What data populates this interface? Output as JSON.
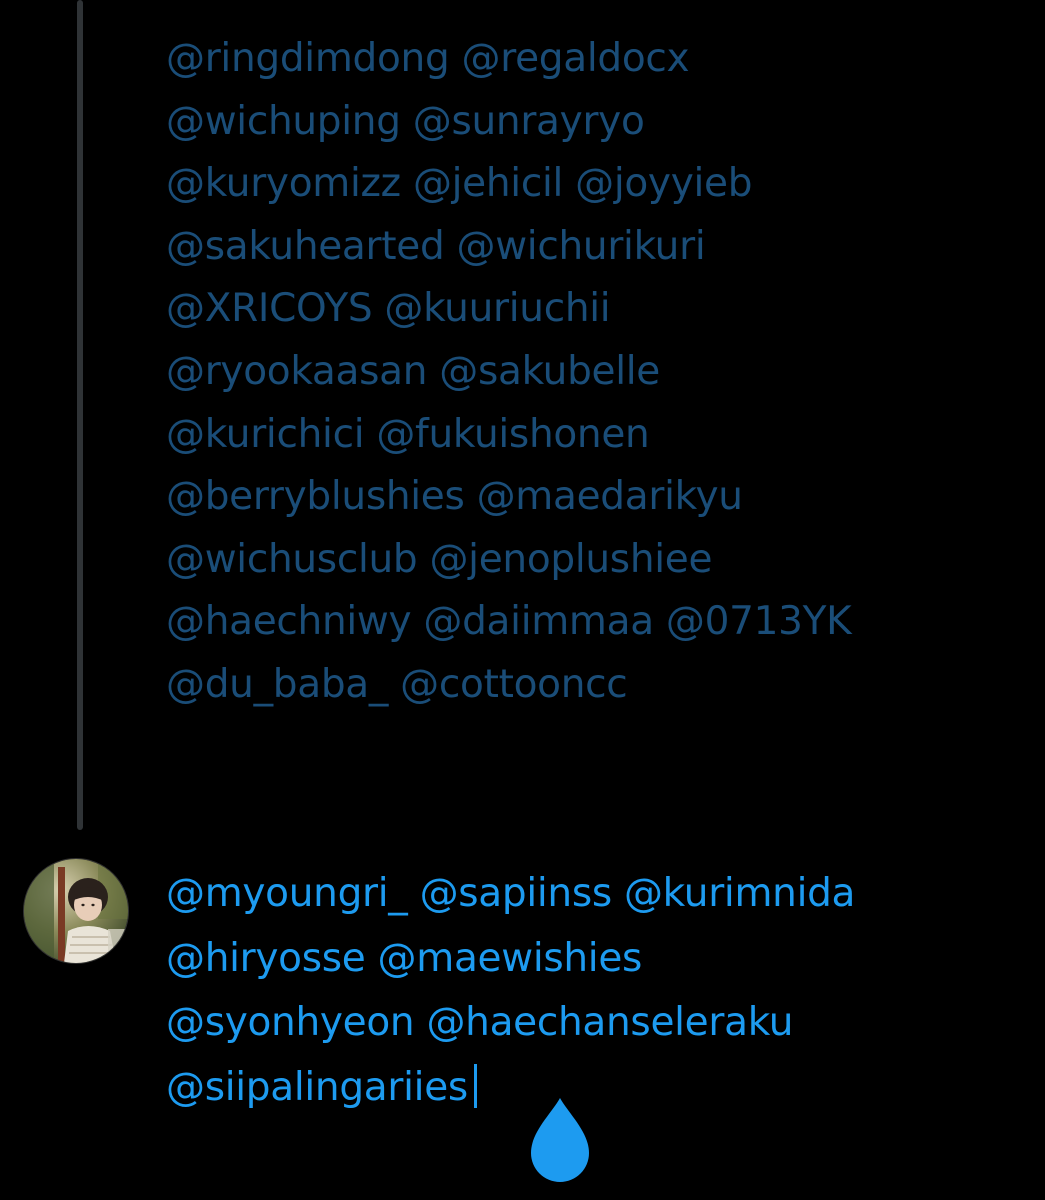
{
  "previous_tweet": {
    "lines": [
      "@ringdimdong @regaldocx",
      "@wichuping @sunrayryo",
      "@kuryomizz @jehicil @joyyieb",
      "@sakuhearted @wichurikuri",
      "@XRICOYS @kuuriuchii",
      "@ryookaasan @sakubelle",
      "@kurichici @fukuishonen",
      "@berryblushies @maedarikyu",
      "@wichusclub @jenoplushiee",
      "@haechniwy @daiimmaa @0713YK",
      "@du_baba_ @cottooncc"
    ]
  },
  "reply_compose": {
    "lines": [
      "@myoungri_ @sapiinss @kurimnida",
      "@hiryosse  @maewishies",
      "@syonhyeon @haechanseleraku",
      "@siipalingariies"
    ]
  },
  "colors": {
    "background": "#000000",
    "previous_text": "#1a4d78",
    "compose_text": "#1d9bf0",
    "thread_line": "#2f3336",
    "cursor": "#1d9bf0"
  },
  "icons": {
    "avatar": "user-avatar-photo",
    "cursor_handle": "text-selection-handle-icon"
  }
}
